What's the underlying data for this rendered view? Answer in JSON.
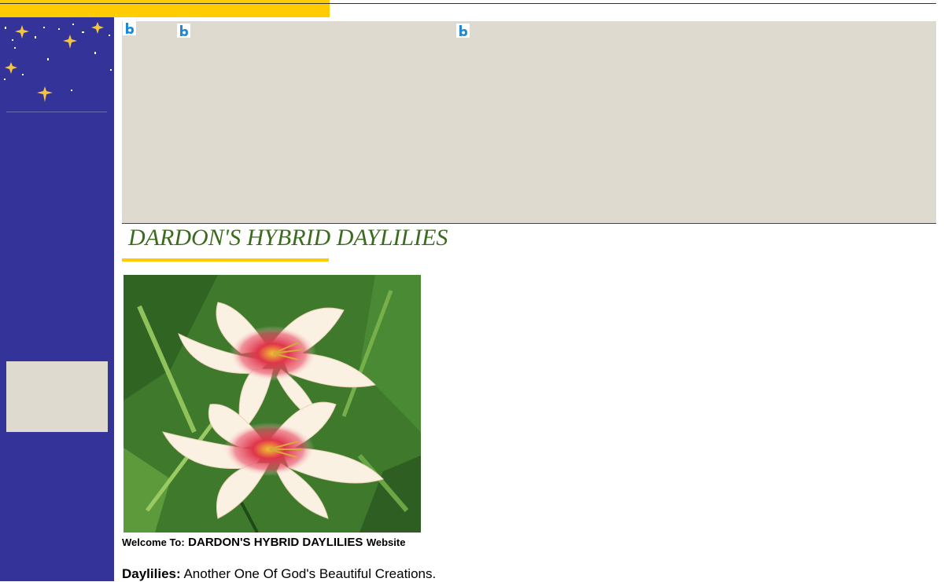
{
  "colors": {
    "accent_yellow": "#ffcc00",
    "sidebar_blue": "#333399",
    "placeholder_gray": "#dedad0",
    "title_green": "#3a6b1e",
    "icon_blue": "#1e8ad6"
  },
  "icons": [
    "bing-b-icon",
    "bing-b-icon",
    "bing-b-icon",
    "star-icon"
  ],
  "site": {
    "title": "DARDON'S HYBRID DAYLILIES",
    "welcome": {
      "prefix": "Welcome To:",
      "name": "DARDON'S HYBRID DAYLILIES",
      "suffix": "Website"
    },
    "tagline": {
      "label": "Daylilies:",
      "text": "Another One Of God's Beautiful Creations."
    }
  }
}
